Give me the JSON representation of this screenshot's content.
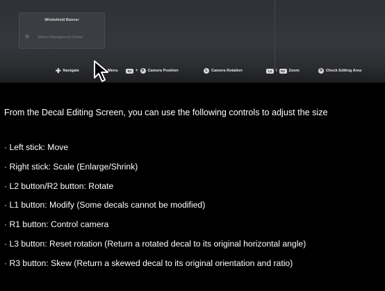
{
  "game_screen": {
    "panel": {
      "title": "Windshield Banner",
      "row_label": "Sticker Background Colour",
      "row_icon": "camera-icon"
    },
    "hint_bar": [
      {
        "glyph": "dpad-icon",
        "label": "Navigate"
      },
      {
        "glyph": "",
        "label": "Menu"
      },
      {
        "glyph": "R1 + R-stick",
        "button_text": "R1",
        "label": "Camera Position"
      },
      {
        "glyph": "L-stick",
        "label": "Camera Rotation"
      },
      {
        "glyph": "L2",
        "button_text": "L2",
        "label": "/"
      },
      {
        "glyph": "R2",
        "button_text": "R2",
        "label": "Zoom"
      },
      {
        "glyph": "R3",
        "label": "Check Editing Area"
      }
    ]
  },
  "intro_text": "From the Decal Editing Screen, you can use the following controls to adjust the size",
  "controls": [
    "· Left stick: Move",
    "· Right stick: Scale (Enlarge/Shrink)",
    "· L2 button/R2 button: Rotate",
    "· L1 button: Modify (Some decals cannot be modified)",
    "· R1 button: Control camera",
    "· L3 button: Reset rotation (Return a rotated decal to its original horizontal angle)",
    "· R3 button: Skew (Return a skewed decal to its original orientation and ratio)"
  ],
  "colors": {
    "background": "#000000",
    "text": "#ffffff",
    "game_panel": "#3b3d42"
  }
}
